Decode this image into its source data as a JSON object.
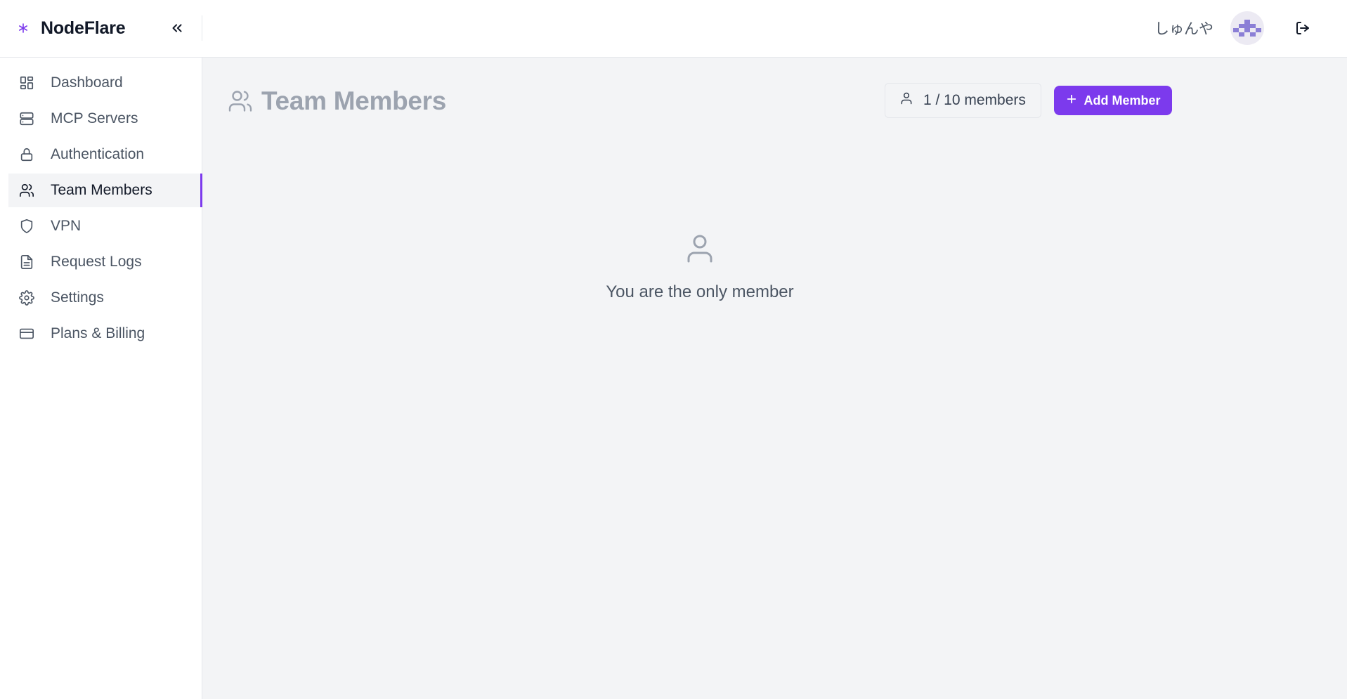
{
  "app": {
    "name": "NodeFlare",
    "accent_color": "#7c3aed"
  },
  "header": {
    "collapse_icon": "chevrons-left-icon",
    "user_name": "しゅんや",
    "logout_icon": "log-out-icon"
  },
  "sidebar": {
    "items": [
      {
        "label": "Dashboard",
        "icon": "dashboard-icon",
        "active": false
      },
      {
        "label": "MCP Servers",
        "icon": "server-icon",
        "active": false
      },
      {
        "label": "Authentication",
        "icon": "lock-icon",
        "active": false
      },
      {
        "label": "Team Members",
        "icon": "users-icon",
        "active": true
      },
      {
        "label": "VPN",
        "icon": "shield-icon",
        "active": false
      },
      {
        "label": "Request Logs",
        "icon": "file-text-icon",
        "active": false
      },
      {
        "label": "Settings",
        "icon": "gear-icon",
        "active": false
      },
      {
        "label": "Plans & Billing",
        "icon": "credit-card-icon",
        "active": false
      }
    ]
  },
  "main": {
    "title": "Team Members",
    "member_count": "1 / 10 members",
    "add_button_label": "Add Member",
    "empty_message": "You are the only member"
  }
}
